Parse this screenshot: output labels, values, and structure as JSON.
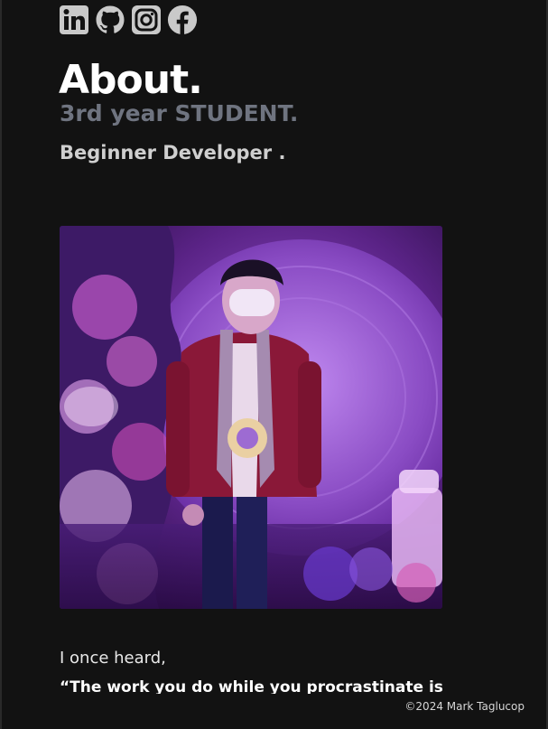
{
  "socials": [
    {
      "name": "LinkedIn",
      "icon": "linkedin-icon"
    },
    {
      "name": "GitHub",
      "icon": "github-icon"
    },
    {
      "name": "Instagram",
      "icon": "instagram-icon"
    },
    {
      "name": "Facebook",
      "icon": "facebook-icon"
    }
  ],
  "about": {
    "title": "About.",
    "subtitle": "3rd year STUDENT.",
    "role": "Beginner Developer ."
  },
  "body": {
    "intro": "I once heard,",
    "quote": "“The work you do while you procrastinate is"
  },
  "footer": {
    "copyright": "©2024 Mark Taglucop"
  },
  "colors": {
    "background": "#121212",
    "title": "#ffffff",
    "subtitle": "#6f7480",
    "icon": "#c9c9c9"
  }
}
